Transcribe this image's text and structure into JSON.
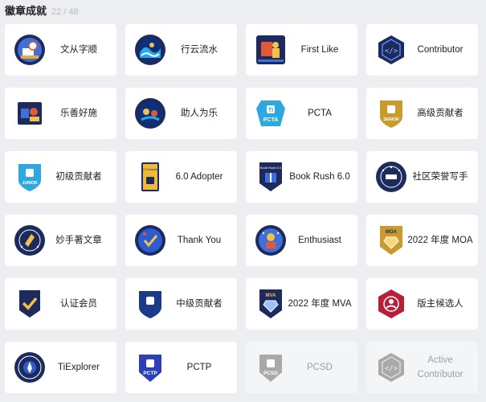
{
  "header": {
    "title": "徽章成就",
    "count": "22 / 48"
  },
  "badges": [
    {
      "label": "文从字顺",
      "icon": "writer-astronaut-badge-icon"
    },
    {
      "label": "行云流水",
      "icon": "wave-badge-icon"
    },
    {
      "label": "First Like",
      "icon": "first-like-badge-icon"
    },
    {
      "label": "Contributor",
      "icon": "contributor-hexagon-icon"
    },
    {
      "label": "乐善好施",
      "icon": "giver-badge-icon"
    },
    {
      "label": "助人为乐",
      "icon": "helper-badge-icon"
    },
    {
      "label": "PCTA",
      "icon": "pcta-shield-icon",
      "badge_text": "PCTA"
    },
    {
      "label": "高级贡献者",
      "icon": "senior-contributor-shield-icon",
      "badge_text": "SENIOR"
    },
    {
      "label": "初级贡献者",
      "icon": "junior-contributor-shield-icon",
      "badge_text": "JUNIOR"
    },
    {
      "label": "6.0 Adopter",
      "icon": "adopter-card-icon",
      "badge_text": "6.0 Adopter"
    },
    {
      "label": "Book Rush 6.0",
      "icon": "book-rush-shield-icon",
      "badge_text": "Book Rush 6.0"
    },
    {
      "label": "社区荣誉写手",
      "icon": "honor-writer-seal-icon"
    },
    {
      "label": "妙手著文章",
      "icon": "skilled-writer-seal-icon"
    },
    {
      "label": "Thank You",
      "icon": "thank-you-badge-icon"
    },
    {
      "label": "Enthusiast",
      "icon": "enthusiast-badge-icon"
    },
    {
      "label": "2022 年度 MOA",
      "icon": "moa-shield-icon",
      "badge_text": "MOA"
    },
    {
      "label": "认证会员",
      "icon": "verified-member-shield-icon"
    },
    {
      "label": "中级贡献者",
      "icon": "mid-contributor-shield-icon"
    },
    {
      "label": "2022 年度 MVA",
      "icon": "mva-shield-icon",
      "badge_text": "MVA"
    },
    {
      "label": "版主候选人",
      "icon": "moderator-candidate-icon"
    },
    {
      "label": "TiExplorer",
      "icon": "tiexplorer-seal-icon"
    },
    {
      "label": "PCTP",
      "icon": "pctp-shield-icon",
      "badge_text": "PCTP"
    },
    {
      "label": "PCSD",
      "icon": "pcsd-shield-icon",
      "badge_text": "PCSD",
      "disabled": true
    },
    {
      "label": "Active Contributor",
      "icon": "active-contributor-hexagon-icon",
      "disabled": true
    }
  ]
}
